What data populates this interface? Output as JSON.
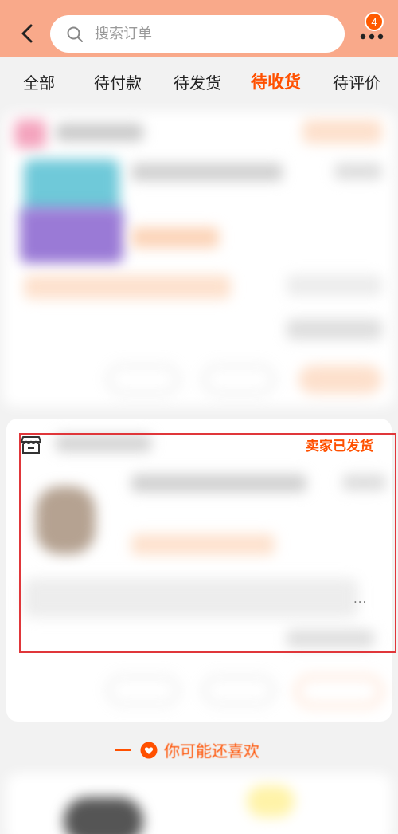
{
  "header": {
    "back_icon": "chevron-left-icon",
    "search_placeholder": "搜索订单",
    "more_icon": "more-dots-icon",
    "badge_count": "4",
    "colors": {
      "header_bg": "#f9a98a",
      "accent": "#ff5000"
    }
  },
  "tabs": [
    {
      "label": "全部",
      "active": false
    },
    {
      "label": "待付款",
      "active": false
    },
    {
      "label": "待发货",
      "active": false
    },
    {
      "label": "待收货",
      "active": true
    },
    {
      "label": "待评价",
      "active": false
    }
  ],
  "order2": {
    "shop_icon": "shop-icon",
    "status": "卖家已发货",
    "more_hint": "..."
  },
  "recommend": {
    "icon": "heart-icon",
    "title": "你可能还喜欢"
  }
}
